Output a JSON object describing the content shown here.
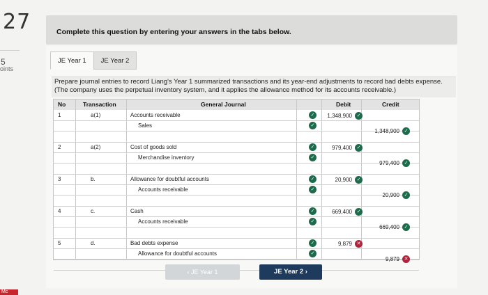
{
  "question": {
    "number": "27",
    "points_value": "5",
    "points_label": "oints"
  },
  "banner": {
    "instruction": "Complete this question by entering your answers in the tabs below."
  },
  "tabs": [
    {
      "label": "JE Year 1",
      "active": true
    },
    {
      "label": "JE Year 2",
      "active": false
    }
  ],
  "prompt": "Prepare journal entries to record Liang's Year 1 summarized transactions and its year-end adjustments to record bad debts expense. (The company uses the perpetual inventory system, and it applies the allowance method for its accounts receivable.)",
  "table": {
    "headers": {
      "no": "No",
      "transaction": "Transaction",
      "journal": "General Journal",
      "debit": "Debit",
      "credit": "Credit"
    },
    "entries": [
      {
        "no": "1",
        "transaction": "a(1)",
        "debit_account": "Accounts receivable",
        "credit_account": "Sales",
        "debit": "1,348,900",
        "credit": "1,348,900",
        "debit_status": "correct",
        "credit_status": "correct"
      },
      {
        "no": "2",
        "transaction": "a(2)",
        "debit_account": "Cost of goods sold",
        "credit_account": "Merchandise inventory",
        "debit": "979,400",
        "credit": "979,400",
        "debit_status": "correct",
        "credit_status": "correct"
      },
      {
        "no": "3",
        "transaction": "b.",
        "debit_account": "Allowance for doubtful accounts",
        "credit_account": "Accounts receivable",
        "debit": "20,900",
        "credit": "20,900",
        "debit_status": "correct",
        "credit_status": "correct"
      },
      {
        "no": "4",
        "transaction": "c.",
        "debit_account": "Cash",
        "credit_account": "Accounts receivable",
        "debit": "669,400",
        "credit": "669,400",
        "debit_status": "correct",
        "credit_status": "correct"
      },
      {
        "no": "5",
        "transaction": "d.",
        "debit_account": "Bad debts expense",
        "credit_account": "Allowance for doubtful accounts",
        "debit": "9,879",
        "credit": "9,879",
        "debit_status": "incorrect",
        "credit_status": "incorrect"
      }
    ]
  },
  "nav": {
    "prev_label": "‹  JE Year 1",
    "next_label": "JE Year 2  ›"
  },
  "footer": {
    "brand": "Mc"
  },
  "icons": {
    "correct": "check-circle-icon",
    "incorrect": "x-circle-icon"
  },
  "colors": {
    "correct": "#1c6b4a",
    "incorrect": "#b2223a",
    "next_button": "#1e3b5e"
  }
}
